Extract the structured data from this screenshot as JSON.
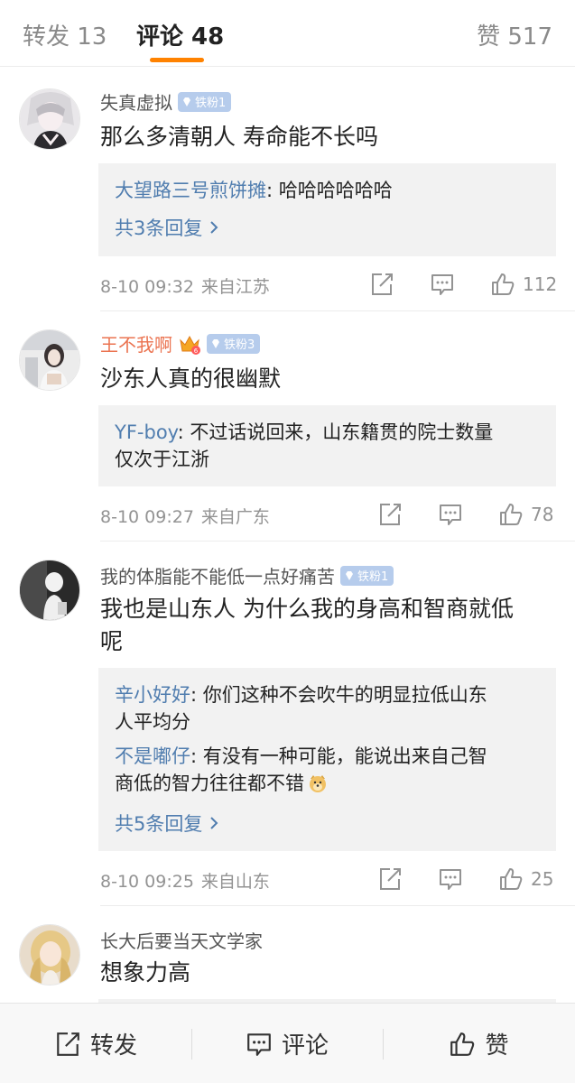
{
  "tabs": {
    "repost": "转发 13",
    "comment": "评论 48",
    "like": "赞 517"
  },
  "comments": [
    {
      "user": "失真虚拟",
      "badge": "铁粉1",
      "text": "那么多清朝人 寿命能不长吗",
      "replies": [
        {
          "name": "大望路三号煎饼摊",
          "text": ": 哈哈哈哈哈哈"
        }
      ],
      "more": "共3条回复",
      "time": "8-10 09:32",
      "location": "来自江苏",
      "likes": "112"
    },
    {
      "user": "王不我啊",
      "badge": "铁粉3",
      "text": "沙东人真的很幽默",
      "replies": [
        {
          "name": "YF-boy",
          "text": ": 不过话说回来，山东籍贯的院士数量",
          "text2": "仅次于江浙"
        }
      ],
      "time": "8-10 09:27",
      "location": "来自广东",
      "likes": "78"
    },
    {
      "user": "我的体脂能不能低一点好痛苦",
      "badge": "铁粉1",
      "text": "我也是山东人 为什么我的身高和智商就低",
      "text2": "呢",
      "replies": [
        {
          "name": "辛小好好",
          "text": ": 你们这种不会吹牛的明显拉低山东",
          "text2": "人平均分"
        },
        {
          "name": "不是嘟仔",
          "text": ": 有没有一种可能，能说出来自己智",
          "text2": "商低的智力往往都不错"
        }
      ],
      "more": "共5条回复",
      "time": "8-10 09:25",
      "location": "来自山东",
      "likes": "25"
    },
    {
      "user": "长大后要当天文学家",
      "text": "想象力高"
    }
  ],
  "bottom": {
    "repost": "转发",
    "comment": "评论",
    "like": "赞"
  },
  "colors": {
    "accent": "#ff8200",
    "link": "#507daf",
    "meta": "#939393",
    "username_vip": "#eb7350"
  }
}
